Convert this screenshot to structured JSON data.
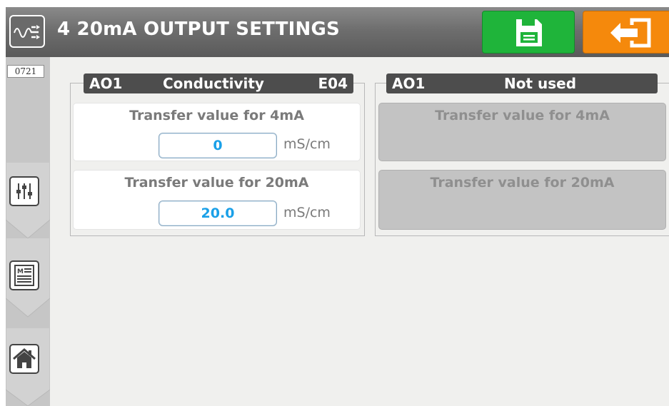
{
  "header": {
    "title": "4 20mA OUTPUT SETTINGS",
    "app_icon": "waveform-settings-icon",
    "save_icon": "floppy-disk-icon",
    "exit_icon": "exit-arrow-icon",
    "colors": {
      "header": "#6e6e6e",
      "save": "#1fb43a",
      "exit": "#f5890c"
    }
  },
  "sidebar": {
    "counter": "0721",
    "buttons": [
      {
        "icon": "sliders-icon"
      },
      {
        "icon": "menu-list-icon"
      },
      {
        "icon": "home-icon"
      }
    ]
  },
  "outputs": [
    {
      "channel": "AO1",
      "assignment": "Conductivity",
      "code": "E04",
      "enabled": true,
      "fields": [
        {
          "label": "Transfer value for 4mA",
          "value": "0",
          "unit": "mS/cm"
        },
        {
          "label": "Transfer value for 20mA",
          "value": "20.0",
          "unit": "mS/cm"
        }
      ]
    },
    {
      "channel": "AO1",
      "assignment": "Not used",
      "code": "",
      "enabled": false,
      "fields": [
        {
          "label": "Transfer value for 4mA"
        },
        {
          "label": "Transfer value for 20mA"
        }
      ]
    }
  ],
  "colors": {
    "value_text": "#1aa0e8",
    "label_text": "#7a7a7a"
  }
}
